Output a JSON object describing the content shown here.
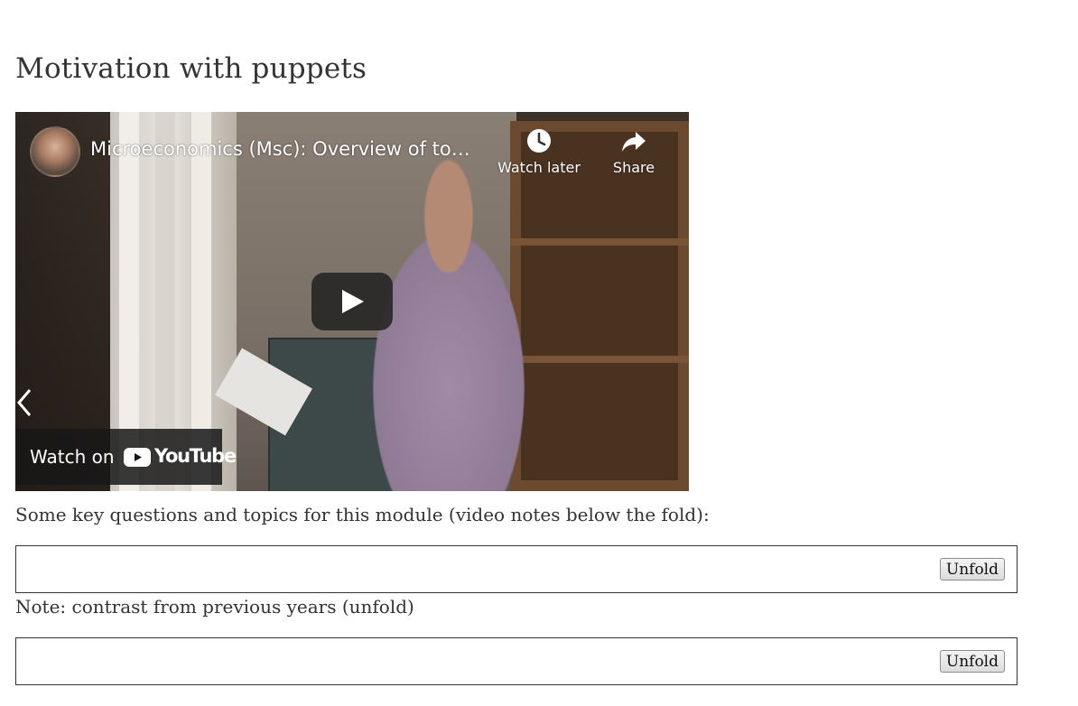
{
  "page": {
    "heading": "Motivation with puppets"
  },
  "video": {
    "title": "Microeconomics (Msc): Overview of to…",
    "watch_later_label": "Watch later",
    "share_label": "Share",
    "watch_on_label": "Watch on",
    "youtube_label": "YouTube",
    "icons": {
      "clock": "clock-icon",
      "share": "share-arrow-icon",
      "play": "play-icon",
      "prev": "chevron-left-icon",
      "logo": "youtube-logo-icon"
    },
    "colors": {
      "play_bg": "#212121",
      "youtube_red": "#ffffff"
    }
  },
  "content": {
    "key_questions_text": "Some key questions and topics for this module (video notes below the fold):",
    "note_text": "Note: contrast from previous years (unfold)",
    "fold_sections": [
      {
        "button_label": "Unfold"
      },
      {
        "button_label": "Unfold"
      }
    ]
  }
}
